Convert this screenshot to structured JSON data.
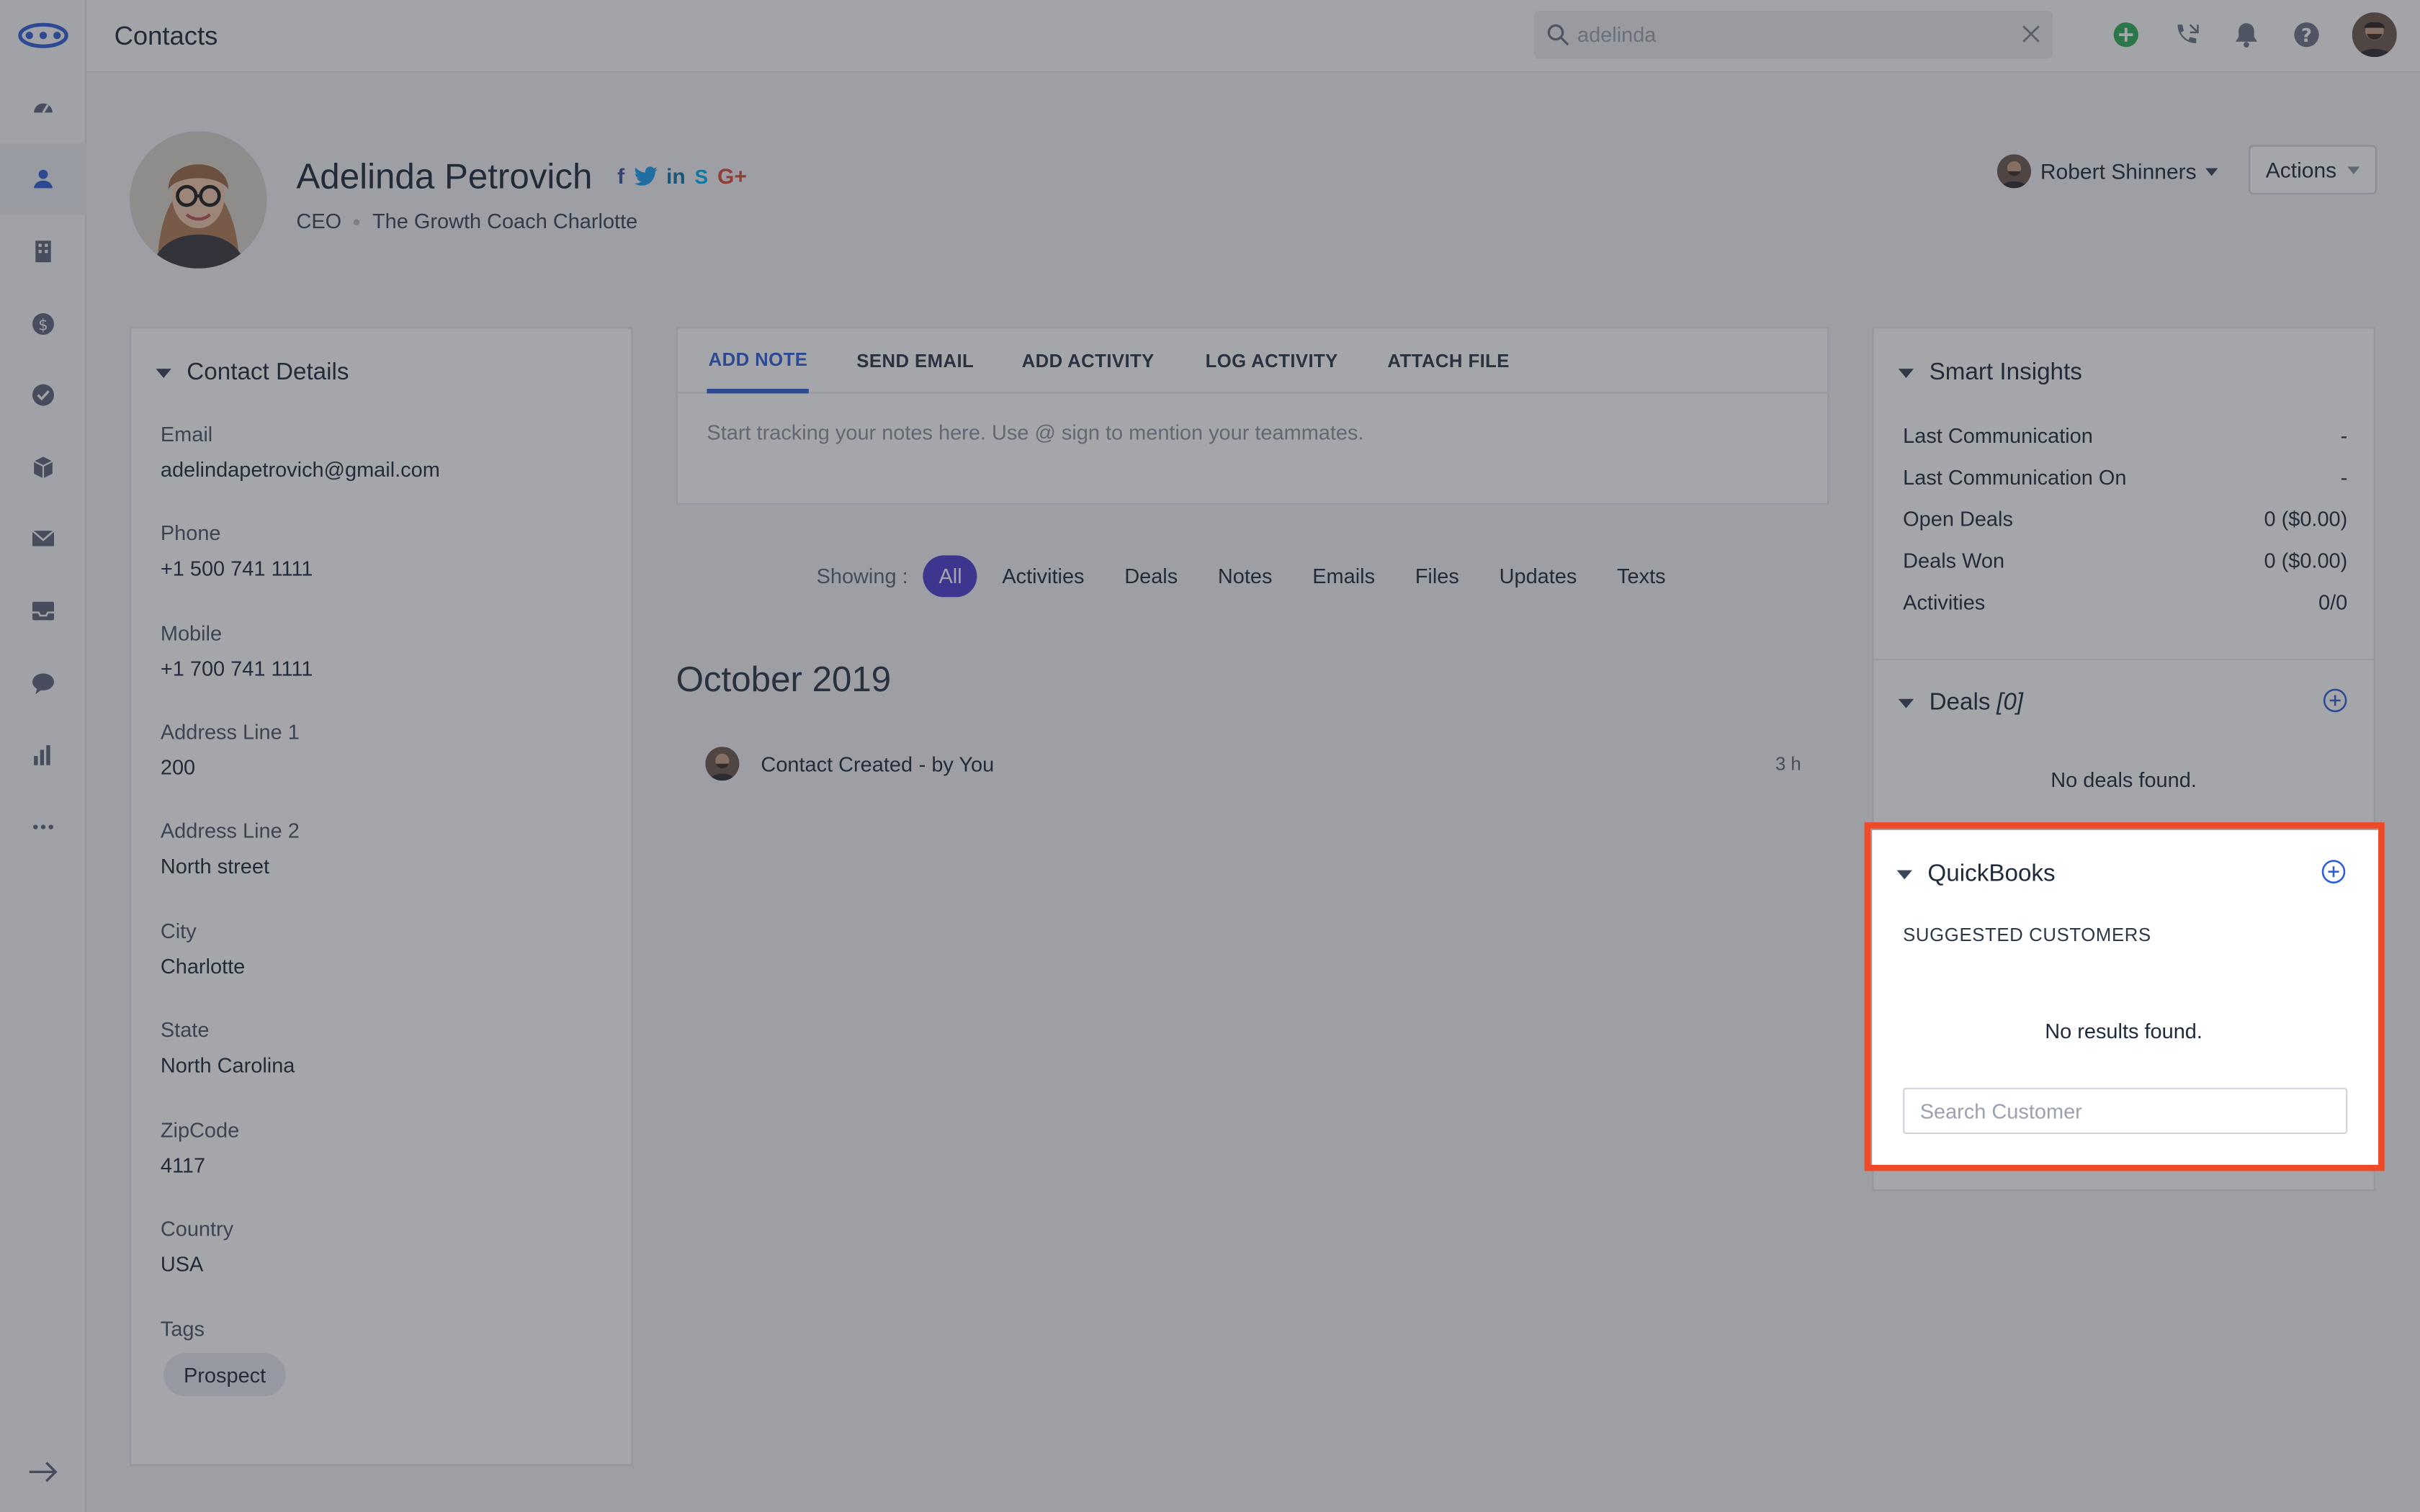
{
  "header": {
    "title": "Contacts",
    "search_value": "adelinda"
  },
  "sidebar": {
    "items": [
      "dashboard-icon",
      "contacts-icon",
      "companies-icon",
      "deals-icon",
      "tasks-icon",
      "products-icon",
      "email-icon",
      "inbox-icon",
      "chat-icon",
      "reports-icon",
      "more-icon"
    ],
    "active": "contacts-icon"
  },
  "profile": {
    "name": "Adelinda Petrovich",
    "title": "CEO",
    "company": "The Growth Coach Charlotte",
    "social": [
      "f",
      "t",
      "in",
      "S",
      "G+"
    ],
    "owner": "Robert Shinners",
    "actions_label": "Actions"
  },
  "contact_details": {
    "heading": "Contact Details",
    "fields": [
      {
        "label": "Email",
        "value": "adelindapetrovich@gmail.com"
      },
      {
        "label": "Phone",
        "value": "+1 500 741 1111"
      },
      {
        "label": "Mobile",
        "value": "+1 700 741 1111"
      },
      {
        "label": "Address Line 1",
        "value": "200"
      },
      {
        "label": "Address Line 2",
        "value": "North street"
      },
      {
        "label": "City",
        "value": "Charlotte"
      },
      {
        "label": "State",
        "value": "North Carolina"
      },
      {
        "label": "ZipCode",
        "value": "4117"
      },
      {
        "label": "Country",
        "value": "USA"
      },
      {
        "label": "Tags",
        "value": ""
      }
    ],
    "tag": "Prospect"
  },
  "composer": {
    "tabs": [
      "ADD NOTE",
      "SEND EMAIL",
      "ADD ACTIVITY",
      "LOG ACTIVITY",
      "ATTACH FILE"
    ],
    "active_tab": "ADD NOTE",
    "placeholder": "Start tracking your notes here. Use @ sign to mention your teammates."
  },
  "filter": {
    "label": "Showing :",
    "options": [
      "All",
      "Activities",
      "Deals",
      "Notes",
      "Emails",
      "Files",
      "Updates",
      "Texts"
    ],
    "active": "All"
  },
  "timeline": {
    "month": "October 2019",
    "entry_title": "Contact Created",
    "entry_by": "- by You",
    "entry_time": "3 h"
  },
  "insights": {
    "heading": "Smart Insights",
    "rows": [
      {
        "label": "Last Communication",
        "value": "-"
      },
      {
        "label": "Last Communication On",
        "value": "-"
      },
      {
        "label": "Open Deals",
        "value": "0 ($0.00)"
      },
      {
        "label": "Deals Won",
        "value": "0 ($0.00)"
      },
      {
        "label": "Activities",
        "value": "0/0"
      }
    ]
  },
  "deals": {
    "heading": "Deals",
    "count": "[0]",
    "empty": "No deals found."
  },
  "quickbooks": {
    "heading": "QuickBooks",
    "subheading": "SUGGESTED CUSTOMERS",
    "empty": "No results found.",
    "search_placeholder": "Search Customer"
  },
  "colors": {
    "accent": "#2f5fd6",
    "pill": "#4b3fcf",
    "highlight": "#ee4a27"
  }
}
